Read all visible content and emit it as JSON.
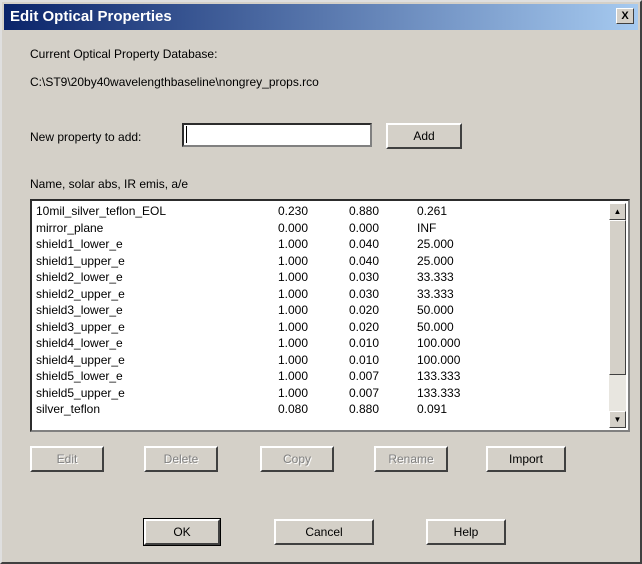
{
  "window": {
    "title": "Edit Optical Properties",
    "close_label": "X"
  },
  "database": {
    "heading": "Current Optical Property Database:",
    "path": "C:\\ST9\\20by40wavelengthbaseline\\nongrey_props.rco"
  },
  "new_property": {
    "label": "New property to add:",
    "value": "",
    "add_label": "Add"
  },
  "list": {
    "header": "Name, solar abs, IR emis, a/e",
    "rows": [
      [
        "10mil_silver_teflon_EOL",
        "0.230",
        "0.880",
        "0.261"
      ],
      [
        "mirror_plane",
        "0.000",
        "0.000",
        "INF"
      ],
      [
        "shield1_lower_e",
        "1.000",
        "0.040",
        "25.000"
      ],
      [
        "shield1_upper_e",
        "1.000",
        "0.040",
        "25.000"
      ],
      [
        "shield2_lower_e",
        "1.000",
        "0.030",
        "33.333"
      ],
      [
        "shield2_upper_e",
        "1.000",
        "0.030",
        "33.333"
      ],
      [
        "shield3_lower_e",
        "1.000",
        "0.020",
        "50.000"
      ],
      [
        "shield3_upper_e",
        "1.000",
        "0.020",
        "50.000"
      ],
      [
        "shield4_lower_e",
        "1.000",
        "0.010",
        "100.000"
      ],
      [
        "shield4_upper_e",
        "1.000",
        "0.010",
        "100.000"
      ],
      [
        "shield5_lower_e",
        "1.000",
        "0.007",
        "133.333"
      ],
      [
        "shield5_upper_e",
        "1.000",
        "0.007",
        "133.333"
      ],
      [
        "silver_teflon",
        "0.080",
        "0.880",
        "0.091"
      ]
    ]
  },
  "actions": {
    "edit": "Edit",
    "delete": "Delete",
    "copy": "Copy",
    "rename": "Rename",
    "import": "Import"
  },
  "footer": {
    "ok": "OK",
    "cancel": "Cancel",
    "help": "Help"
  },
  "icons": {
    "close": "close-icon",
    "scroll_up": "scroll-up-icon",
    "scroll_down": "scroll-down-icon"
  }
}
